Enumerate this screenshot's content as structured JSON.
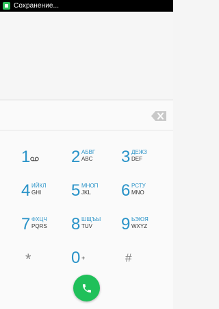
{
  "status_bar": {
    "text": "Сохранение..."
  },
  "dialer": {
    "number": "",
    "keys": [
      {
        "num": "1",
        "letters": "",
        "letters_en": "",
        "icon": "voicemail-icon"
      },
      {
        "num": "2",
        "letters": "АБВГ",
        "letters_en": "ABC"
      },
      {
        "num": "3",
        "letters": "ДЕЖЗ",
        "letters_en": "DEF"
      },
      {
        "num": "4",
        "letters": "ИЙКЛ",
        "letters_en": "GHI"
      },
      {
        "num": "5",
        "letters": "МНОП",
        "letters_en": "JKL"
      },
      {
        "num": "6",
        "letters": "РСТУ",
        "letters_en": "MNO"
      },
      {
        "num": "7",
        "letters": "ФХЦЧ",
        "letters_en": "PQRS"
      },
      {
        "num": "8",
        "letters": "ШЩЪЫ",
        "letters_en": "TUV"
      },
      {
        "num": "9",
        "letters": "ЬЭЮЯ",
        "letters_en": "WXYZ"
      }
    ],
    "star": "*",
    "zero": "0",
    "zero_plus": "+",
    "hash": "#"
  },
  "colors": {
    "accent": "#2a93c8",
    "call": "#20c05a"
  }
}
